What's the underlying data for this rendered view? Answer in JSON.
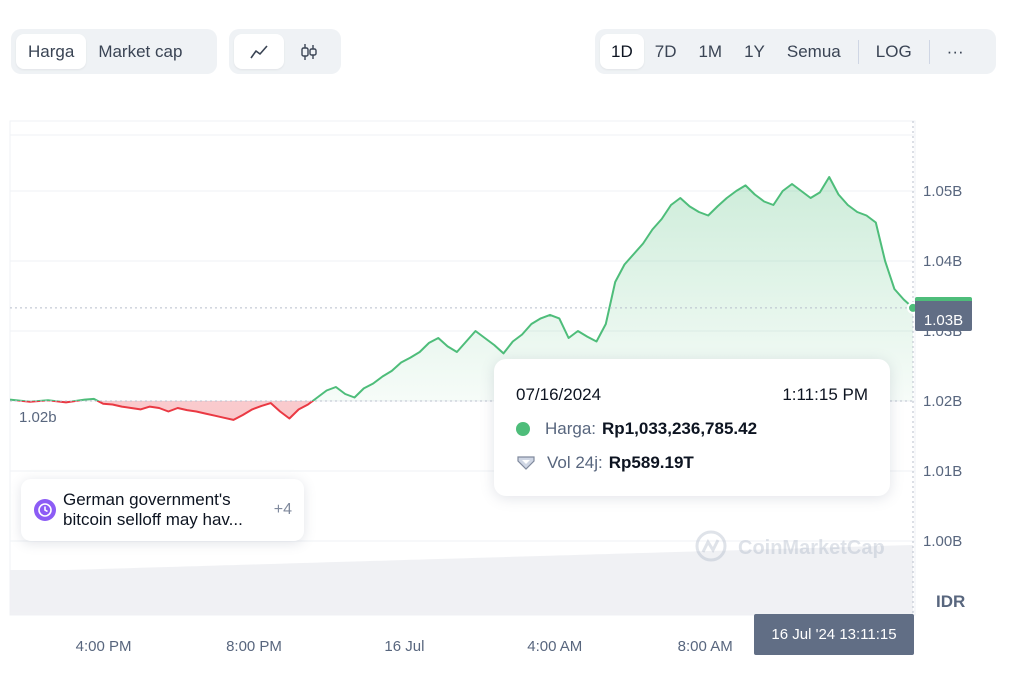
{
  "metric_toggle": {
    "options": [
      "Harga",
      "Market cap"
    ],
    "selected": "Harga"
  },
  "chart_type_toggle": {
    "options": [
      "line-chart-icon",
      "candlestick-icon"
    ],
    "selected": "line-chart-icon"
  },
  "range_toggle": {
    "options": [
      "1D",
      "7D",
      "1M",
      "1Y",
      "Semua"
    ],
    "selected": "1D",
    "log_label": "LOG",
    "more_label": "···"
  },
  "tooltip": {
    "date": "07/16/2024",
    "time": "1:11:15 PM",
    "price_label": "Harga:",
    "price_value": "Rp1,033,236,785.42",
    "volume_label": "Vol 24j:",
    "volume_value": "Rp589.19T"
  },
  "news": {
    "text": "German government's bitcoin selloff may hav...",
    "more_count": "+4"
  },
  "price_badge": "1.03B",
  "time_badge": "16 Jul '24 13:11:15",
  "baseline_badge": "1.02b",
  "currency_label": "IDR",
  "watermark": "CoinMarketCap",
  "chart_data": {
    "type": "line",
    "title": "",
    "xlabel": "",
    "ylabel": "",
    "y_unit": "IDR",
    "ylim": [
      0.99,
      1.058
    ],
    "y_ticks": [
      1.0,
      1.01,
      1.02,
      1.03,
      1.04,
      1.05
    ],
    "y_tick_labels": [
      "1.00B",
      "1.01B",
      "1.02B",
      "1.03B",
      "1.04B",
      "1.05B"
    ],
    "x_tick_labels": [
      "4:00 PM",
      "8:00 PM",
      "16 Jul",
      "4:00 AM",
      "8:00 AM"
    ],
    "baseline": 1.02,
    "x_hours": [
      0.0,
      1.0,
      3.0,
      5.0,
      7.0,
      9.0,
      11.0,
      13.0,
      15.0,
      17.0,
      19.0,
      21.0,
      23.0
    ],
    "series": [
      {
        "values": [
          1.0198,
          1.02,
          1.0202,
          1.0203,
          1.0196,
          1.0195,
          1.0192,
          1.019,
          1.0188,
          1.0192,
          1.019,
          1.0185,
          1.019,
          1.0187,
          1.0185,
          1.0182,
          1.0179,
          1.0176,
          1.0173,
          1.018,
          1.0188,
          1.0193,
          1.0197,
          1.0185,
          1.0175,
          1.0188,
          1.0195,
          1.0205,
          1.0215,
          1.022,
          1.021,
          1.0205,
          1.0218,
          1.0225,
          1.0235,
          1.0243,
          1.0255,
          1.0262,
          1.027,
          1.0283,
          1.029,
          1.0278,
          1.027,
          1.0285,
          1.03,
          1.029,
          1.028,
          1.0268,
          1.0285,
          1.0295,
          1.031,
          1.0318,
          1.0323,
          1.0318,
          1.029,
          1.03,
          1.0292,
          1.0285,
          1.031,
          1.037,
          1.0395,
          1.041,
          1.0425,
          1.0445,
          1.046,
          1.048,
          1.049,
          1.0478,
          1.047,
          1.0465,
          1.0478,
          1.049,
          1.05,
          1.0508,
          1.0495,
          1.0485,
          1.048,
          1.05,
          1.051,
          1.05,
          1.049,
          1.0498,
          1.052,
          1.0495,
          1.048,
          1.047,
          1.0465,
          1.0455,
          1.04,
          1.036,
          1.0345,
          1.0333
        ]
      }
    ],
    "volume_24h_trend": "rising",
    "grid": true,
    "legend": "none"
  }
}
